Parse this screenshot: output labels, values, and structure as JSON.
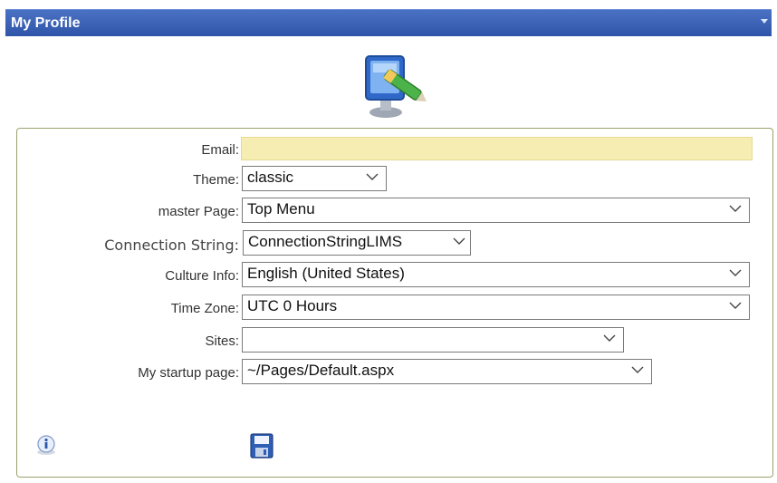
{
  "window": {
    "title": "My Profile"
  },
  "form": {
    "email": {
      "label": "Email:",
      "value": ""
    },
    "theme": {
      "label": "Theme:",
      "value": "classic"
    },
    "master_page": {
      "label": "master Page:",
      "value": "Top Menu"
    },
    "connection_string": {
      "label": "Connection String:",
      "value": "ConnectionStringLIMS"
    },
    "culture_info": {
      "label": "Culture Info:",
      "value": "English (United States)"
    },
    "time_zone": {
      "label": "Time Zone:",
      "value": "UTC 0 Hours"
    },
    "sites": {
      "label": "Sites:",
      "value": ""
    },
    "startup_page": {
      "label": "My startup page:",
      "value": "~/Pages/Default.aspx"
    }
  },
  "icons": {
    "logo": "profile-monitor-icon",
    "info": "info-icon",
    "save": "save-icon",
    "collapse": "chevron-down-icon"
  },
  "colors": {
    "titlebar": "#3a62b8",
    "email_field_bg": "#f6edb3",
    "panel_border": "#9aa36a"
  }
}
